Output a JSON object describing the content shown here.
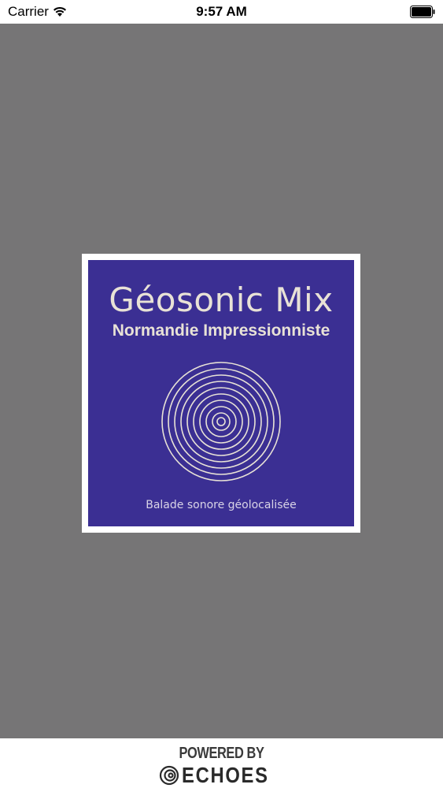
{
  "status_bar": {
    "carrier": "Carrier",
    "time": "9:57 AM",
    "icons": [
      "wifi-icon",
      "battery-icon"
    ]
  },
  "splash": {
    "background_color": "#767576",
    "logo": {
      "title": "Géosonic Mix",
      "subtitle": "Normandie Impressionniste",
      "tagline": "Balade sonore géolocalisée",
      "background_color": "#3b2f93",
      "text_color": "#e8e2d6",
      "icon": "concentric-rings-icon"
    }
  },
  "footer": {
    "powered_by": "POWERED BY",
    "brand": "ECHOES",
    "brand_icon": "echoes-swirl-icon"
  }
}
